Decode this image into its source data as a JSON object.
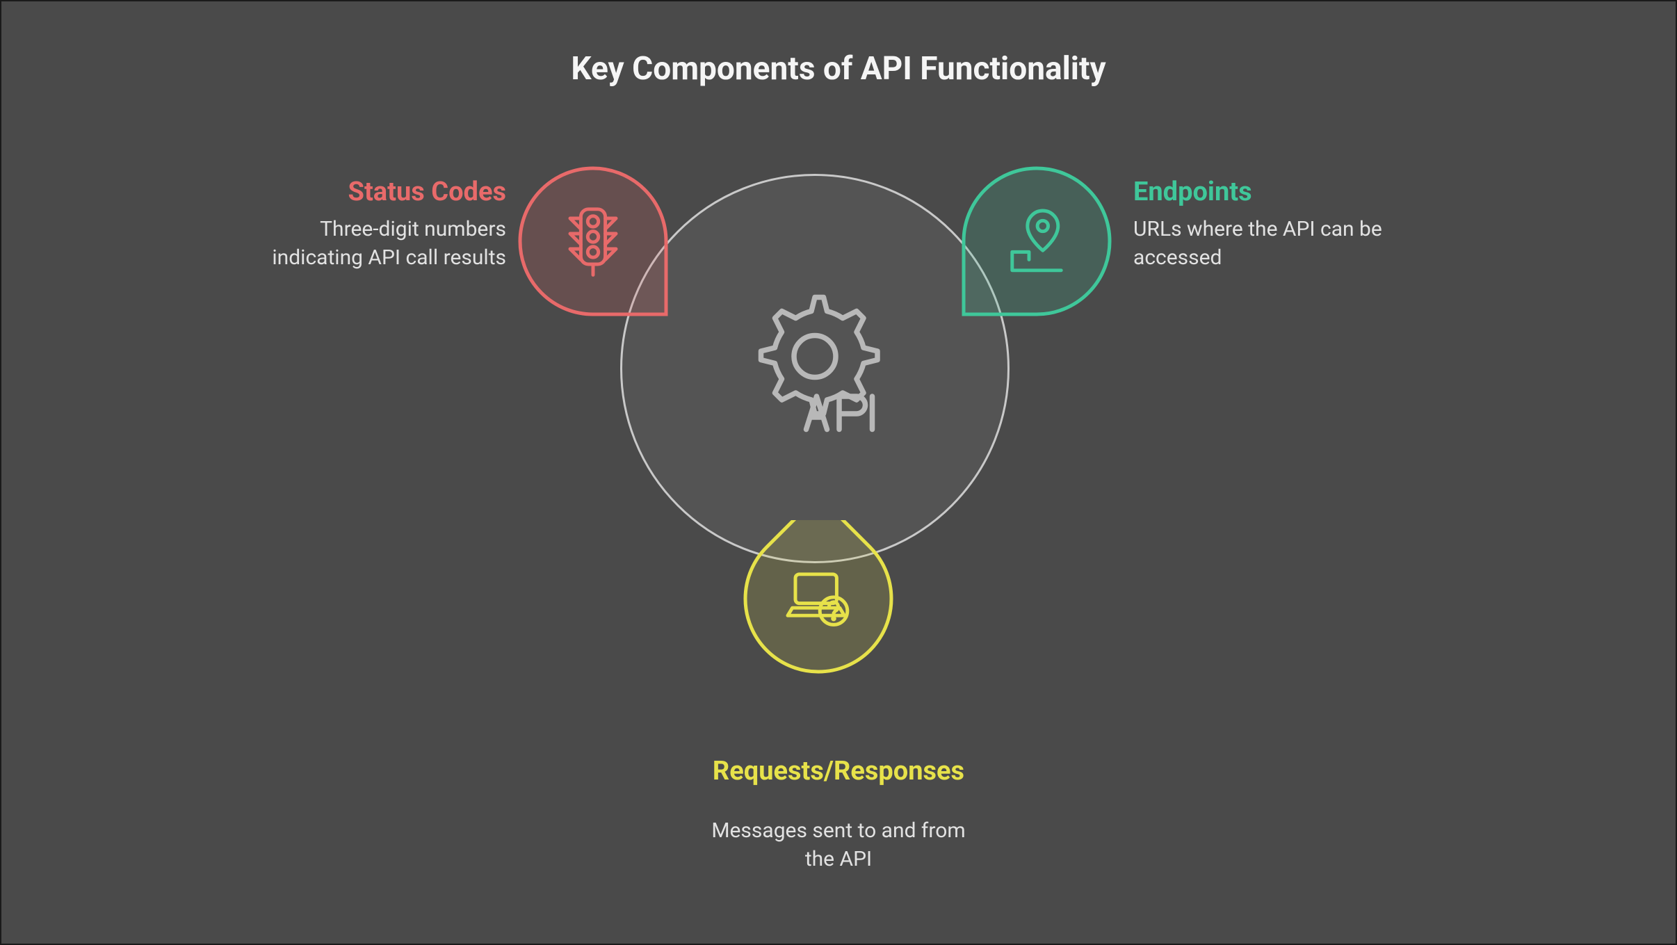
{
  "title": "Key Components of API Functionality",
  "center": {
    "label": "API",
    "icon": "gear-api-icon"
  },
  "components": [
    {
      "key": "status_codes",
      "heading": "Status Codes",
      "description": "Three-digit numbers indicating API call results",
      "color": "#e86a6a",
      "icon": "traffic-light-icon",
      "position": "top-left"
    },
    {
      "key": "endpoints",
      "heading": "Endpoints",
      "description": "URLs where the API can be accessed",
      "color": "#3fc79a",
      "icon": "location-pin-icon",
      "position": "top-right"
    },
    {
      "key": "requests_responses",
      "heading": "Requests/Responses",
      "description": "Messages sent to and from the API",
      "color": "#e7e24a",
      "icon": "laptop-question-icon",
      "position": "bottom"
    }
  ]
}
